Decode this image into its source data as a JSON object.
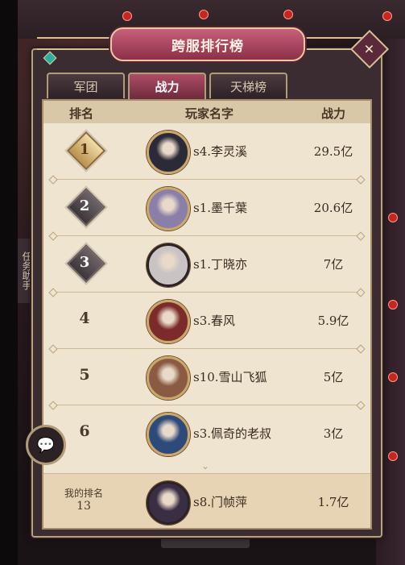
{
  "title": "跨服排行榜",
  "tabs": [
    {
      "label": "军团",
      "active": false
    },
    {
      "label": "战力",
      "active": true
    },
    {
      "label": "天梯榜",
      "active": false
    }
  ],
  "columns": {
    "rank": "排名",
    "name": "玩家名字",
    "power": "战力"
  },
  "rows": [
    {
      "rank": "1",
      "name": "s4.李灵溪",
      "power": "29.5亿",
      "avatar_color": "#2b2a38"
    },
    {
      "rank": "2",
      "name": "s1.墨千葉",
      "power": "20.6亿",
      "avatar_color": "#8a7fa8"
    },
    {
      "rank": "3",
      "name": "s1.丁晓亦",
      "power": "7亿",
      "avatar_color": "#c9c3c3"
    },
    {
      "rank": "4",
      "name": "s3.春风",
      "power": "5.9亿",
      "avatar_color": "#7a2b2a"
    },
    {
      "rank": "5",
      "name": "s10.雪山飞狐",
      "power": "5亿",
      "avatar_color": "#8a5a42"
    },
    {
      "rank": "6",
      "name": "s3.佩奇的老叔",
      "power": "3亿",
      "avatar_color": "#2e4a7a"
    }
  ],
  "my_rank": {
    "label": "我的排名",
    "rank": "13",
    "name": "s8.门帧萍",
    "power": "1.7亿",
    "avatar_color": "#3a2e45"
  },
  "side_tab": "任务助手",
  "icons": {
    "chat": "chat-bubble-icon",
    "close": "close-x-icon",
    "scroll": "chevron-down-icon"
  }
}
